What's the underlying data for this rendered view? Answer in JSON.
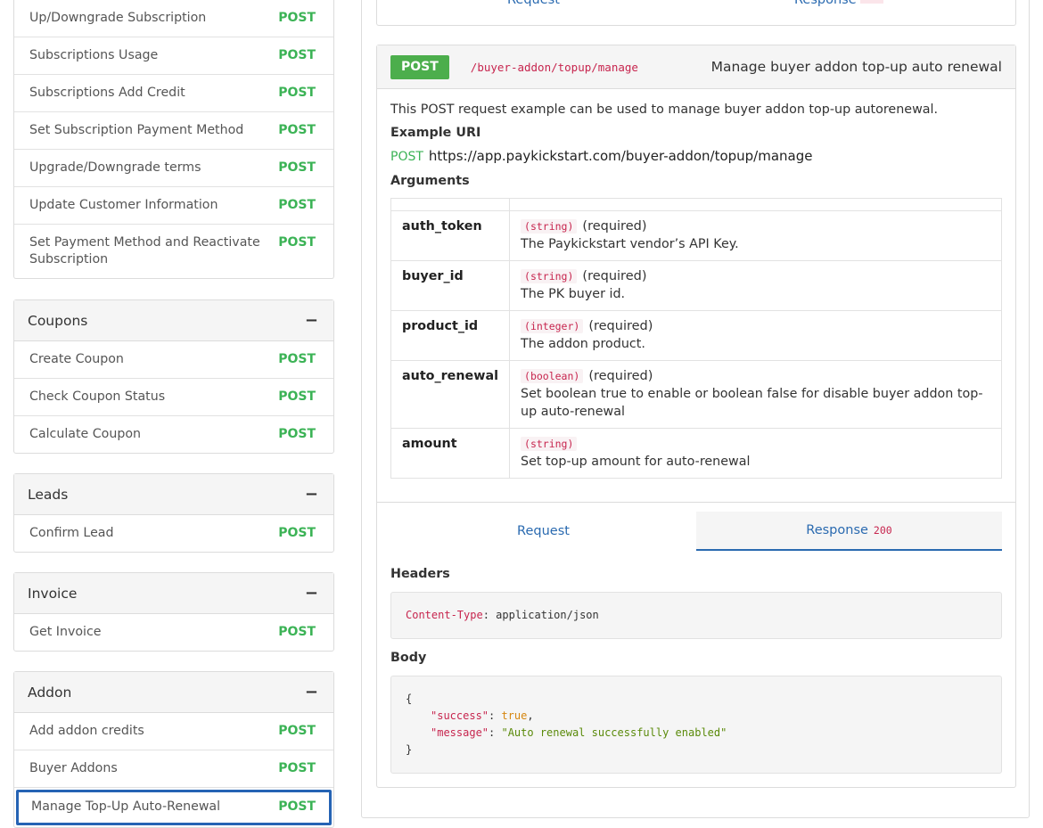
{
  "sidebar": {
    "top_items": [
      {
        "label": "Up/Downgrade Subscription",
        "method": "POST"
      },
      {
        "label": "Subscriptions Usage",
        "method": "POST"
      },
      {
        "label": "Subscriptions Add Credit",
        "method": "POST"
      },
      {
        "label": "Set Subscription Payment Method",
        "method": "POST"
      },
      {
        "label": "Upgrade/Downgrade terms",
        "method": "POST"
      },
      {
        "label": "Update Customer Information",
        "method": "POST"
      },
      {
        "label": "Set Payment Method and Reactivate Subscription",
        "method": "POST"
      }
    ],
    "coupons": {
      "title": "Coupons",
      "items": [
        {
          "label": "Create Coupon",
          "method": "POST"
        },
        {
          "label": "Check Coupon Status",
          "method": "POST"
        },
        {
          "label": "Calculate Coupon",
          "method": "POST"
        }
      ]
    },
    "leads": {
      "title": "Leads",
      "items": [
        {
          "label": "Confirm Lead",
          "method": "POST"
        }
      ]
    },
    "invoice": {
      "title": "Invoice",
      "items": [
        {
          "label": "Get Invoice",
          "method": "POST"
        }
      ]
    },
    "addon": {
      "title": "Addon",
      "items": [
        {
          "label": "Add addon credits",
          "method": "POST"
        },
        {
          "label": "Buyer Addons",
          "method": "POST"
        },
        {
          "label": "Manage Top-Up Auto-Renewal",
          "method": "POST"
        }
      ]
    },
    "collapse_symbol": "−"
  },
  "prev_card": {
    "request_tab": "Request",
    "response_tab": "Response"
  },
  "endpoint": {
    "method": "POST",
    "path": "/buyer-addon/topup/manage",
    "summary": "Manage buyer addon top-up auto renewal",
    "description": "This POST request example can be used to manage buyer addon top-up autorenewal.",
    "example_uri_label": "Example URI",
    "example_uri_method": "POST",
    "example_uri": "https://app.paykickstart.com/buyer-addon/topup/manage",
    "arguments_label": "Arguments",
    "arguments": [
      {
        "name": "auth_token",
        "type": "(string)",
        "required": "(required)",
        "desc": "The Paykickstart vendor’s API Key."
      },
      {
        "name": "buyer_id",
        "type": "(string)",
        "required": "(required)",
        "desc": "The PK buyer id."
      },
      {
        "name": "product_id",
        "type": "(integer)",
        "required": "(required)",
        "desc": "The addon product."
      },
      {
        "name": "auto_renewal",
        "type": "(boolean)",
        "required": "(required)",
        "desc": "Set boolean true to enable or boolean false for disable buyer addon top-up auto-renewal"
      },
      {
        "name": "amount",
        "type": "(string)",
        "required": "",
        "desc": "Set top-up amount for auto-renewal"
      }
    ]
  },
  "tabs": {
    "request": "Request",
    "response": "Response",
    "response_code": "200"
  },
  "response": {
    "headers_label": "Headers",
    "header_key": "Content-Type",
    "header_value": "application/json",
    "body_label": "Body",
    "open_brace": "{",
    "close_brace": "}",
    "success_key": "\"success\"",
    "success_value": "true",
    "message_key": "\"message\"",
    "message_value": "\"Auto renewal successfully enabled\""
  }
}
